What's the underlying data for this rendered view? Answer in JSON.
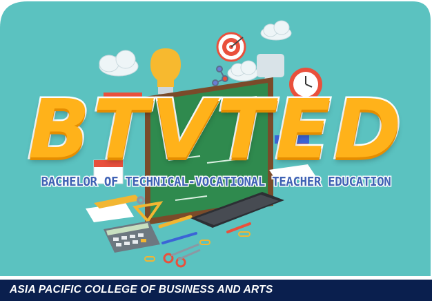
{
  "banner": {
    "acronym": "BTVTED",
    "program_name": "BACHELOR OF TECHNICAL-VOCATIONAL TEACHER EDUCATION"
  },
  "footer": {
    "institution": "ASIA PACIFIC COLLEGE OF BUSINESS AND ARTS"
  },
  "colors": {
    "background": "#5bc2c0",
    "acronym": "#ffb21a",
    "program_name": "#3f62b4",
    "footer_bar": "#0a1f4e"
  },
  "icons": [
    "cloud-icon",
    "lightbulb-icon",
    "target-icon",
    "speech-bubble-icon",
    "clock-icon",
    "chalkboard-icon",
    "books-icon",
    "calendar-icon",
    "ruler-icon",
    "calculator-icon",
    "keyboard-icon",
    "scissors-icon",
    "pencil-icon",
    "paper-clip-icon"
  ]
}
